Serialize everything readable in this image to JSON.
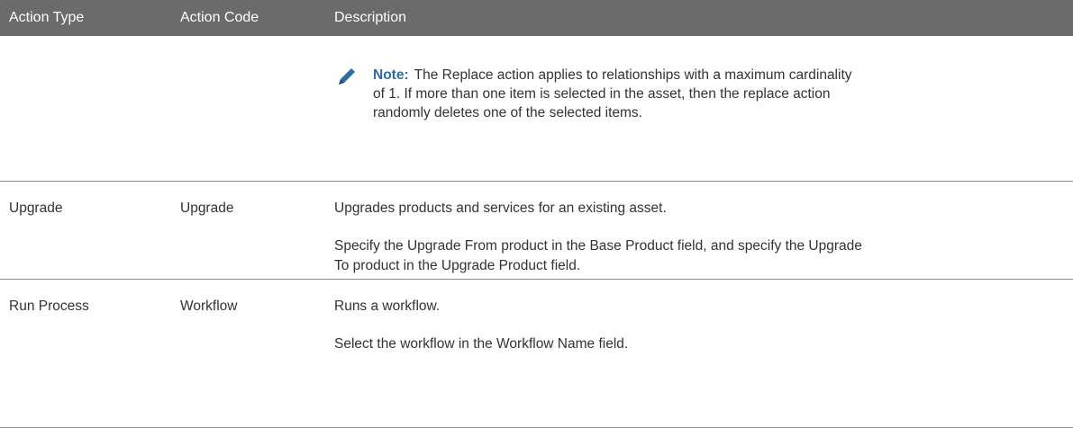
{
  "table": {
    "headers": [
      "Action Type",
      "Action Code",
      "Description"
    ],
    "note": {
      "label": "Note:",
      "lines": [
        "The Replace action applies to relationships with a maximum cardinality",
        "of 1. If more than one item is selected in the asset, then the replace action",
        "randomly deletes one of the selected items."
      ],
      "icon": "pencil-icon"
    },
    "rows": [
      {
        "action_type": "Upgrade",
        "action_code": "Upgrade",
        "description": [
          "Upgrades products and services for an existing asset.",
          "Specify the Upgrade From product in the Base Product field, and specify the Upgrade",
          "To product in the Upgrade Product field."
        ]
      },
      {
        "action_type": "Run Process",
        "action_code": "Workflow",
        "description": [
          "Runs a workflow.",
          "Select the workflow in the Workflow Name field."
        ]
      }
    ]
  },
  "colors": {
    "header_bg": "#6b6b6b",
    "note_label": "#2e6da4",
    "icon": "#2e6da4"
  }
}
